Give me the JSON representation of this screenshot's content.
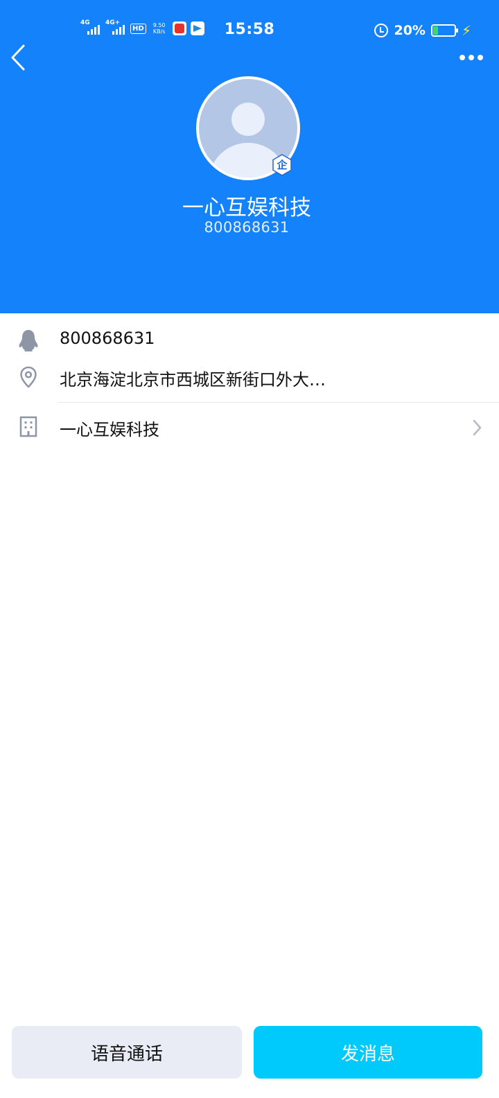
{
  "status_bar": {
    "signal_1_tag": "4G",
    "signal_2_tag": "4G+",
    "hd_label": "HD",
    "network_speed": "9.50",
    "network_unit": "KB/s",
    "time": "15:58",
    "battery_percent": "20%"
  },
  "profile": {
    "name": "一心互娱科技",
    "id": "800868631",
    "enterprise_badge": "企"
  },
  "info": {
    "qq_number": "800868631",
    "location": "北京海淀北京市西城区新街口外大…",
    "company": "一心互娱科技"
  },
  "actions": {
    "voice_call": "语音通话",
    "send_message": "发消息"
  },
  "colors": {
    "header_blue": "#1482FA",
    "message_button": "#00CAFC",
    "voice_button": "#E9ECF5"
  }
}
